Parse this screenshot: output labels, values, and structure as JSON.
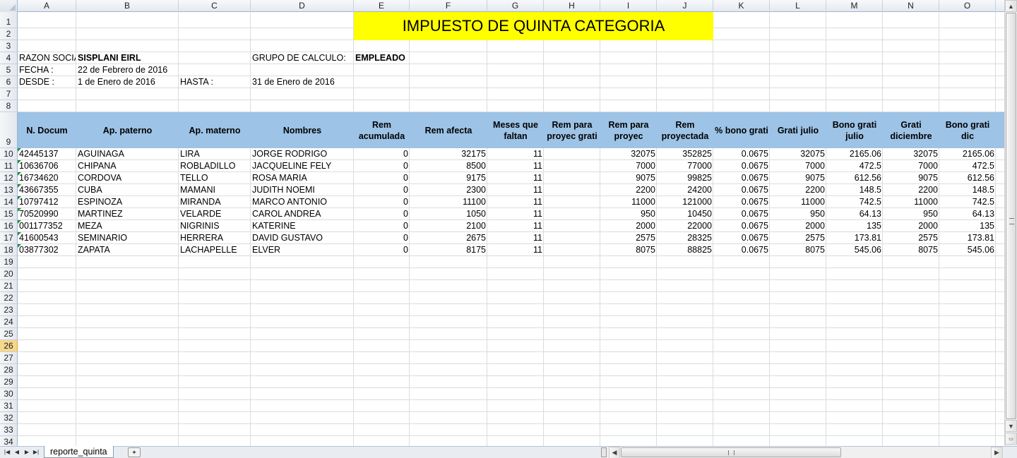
{
  "sheet": {
    "columns": [
      "A",
      "B",
      "C",
      "D",
      "E",
      "F",
      "G",
      "H",
      "I",
      "J",
      "K",
      "L",
      "M",
      "N",
      "O"
    ],
    "rows": [
      "1",
      "2",
      "3",
      "4",
      "5",
      "6",
      "7",
      "8",
      "9",
      "10",
      "11",
      "12",
      "13",
      "14",
      "15",
      "16",
      "17",
      "18",
      "19",
      "20",
      "21",
      "22",
      "23",
      "24",
      "25",
      "26",
      "27",
      "28",
      "29",
      "30",
      "31",
      "32",
      "33",
      "34"
    ],
    "active_row": "26"
  },
  "title": "IMPUESTO DE QUINTA CATEGORIA",
  "info": {
    "razon_label": "RAZON SOCIAL",
    "razon_value": "SISPLANI EIRL",
    "grupo_label": "GRUPO DE CALCULO:",
    "grupo_value": "EMPLEADO",
    "fecha_label": "FECHA :",
    "fecha_value": "22 de Febrero de 2016",
    "desde_label": "DESDE :",
    "desde_value": "1 de Enero de 2016",
    "hasta_label": "HASTA :",
    "hasta_value": "31 de Enero de 2016"
  },
  "headers": [
    "N. Docum",
    "Ap. paterno",
    "Ap. materno",
    "Nombres",
    "Rem acumulada",
    "Rem afecta",
    "Meses que faltan",
    "Rem para proyec grati",
    "Rem para proyec",
    "Rem proyectada",
    "% bono grati",
    "Grati julio",
    "Bono grati julio",
    "Grati diciembre",
    "Bono grati dic"
  ],
  "records": [
    [
      "42445137",
      "AGUINAGA",
      "LIRA",
      "JORGE RODRIGO",
      "0",
      "32175",
      "11",
      "",
      "32075",
      "352825",
      "0.0675",
      "32075",
      "2165.06",
      "32075",
      "2165.06"
    ],
    [
      "10636706",
      "CHIPANA",
      "ROBLADILLO",
      "JACQUELINE FELY",
      "0",
      "8500",
      "11",
      "",
      "7000",
      "77000",
      "0.0675",
      "7000",
      "472.5",
      "7000",
      "472.5"
    ],
    [
      "16734620",
      "CORDOVA",
      "TELLO",
      "ROSA MARIA",
      "0",
      "9175",
      "11",
      "",
      "9075",
      "99825",
      "0.0675",
      "9075",
      "612.56",
      "9075",
      "612.56"
    ],
    [
      "43667355",
      "CUBA",
      "MAMANI",
      "JUDITH NOEMI",
      "0",
      "2300",
      "11",
      "",
      "2200",
      "24200",
      "0.0675",
      "2200",
      "148.5",
      "2200",
      "148.5"
    ],
    [
      "10797412",
      "ESPINOZA",
      "MIRANDA",
      "MARCO ANTONIO",
      "0",
      "11100",
      "11",
      "",
      "11000",
      "121000",
      "0.0675",
      "11000",
      "742.5",
      "11000",
      "742.5"
    ],
    [
      "70520990",
      "MARTINEZ",
      "VELARDE",
      "CAROL ANDREA",
      "0",
      "1050",
      "11",
      "",
      "950",
      "10450",
      "0.0675",
      "950",
      "64.13",
      "950",
      "64.13"
    ],
    [
      "001177352",
      "MEZA",
      "NIGRINIS",
      "KATERINE",
      "0",
      "2100",
      "11",
      "",
      "2000",
      "22000",
      "0.0675",
      "2000",
      "135",
      "2000",
      "135"
    ],
    [
      "41600543",
      "SEMINARIO",
      "HERRERA",
      "DAVID GUSTAVO",
      "0",
      "2675",
      "11",
      "",
      "2575",
      "28325",
      "0.0675",
      "2575",
      "173.81",
      "2575",
      "173.81"
    ],
    [
      "03877302",
      "ZAPATA",
      "LACHAPELLE",
      "ELVER",
      "0",
      "8175",
      "11",
      "",
      "8075",
      "88825",
      "0.0675",
      "8075",
      "545.06",
      "8075",
      "545.06"
    ]
  ],
  "sheet_tab": "reporte_quinta",
  "nav_icons": [
    "first-sheet-icon",
    "prev-sheet-icon",
    "next-sheet-icon",
    "last-sheet-icon"
  ]
}
